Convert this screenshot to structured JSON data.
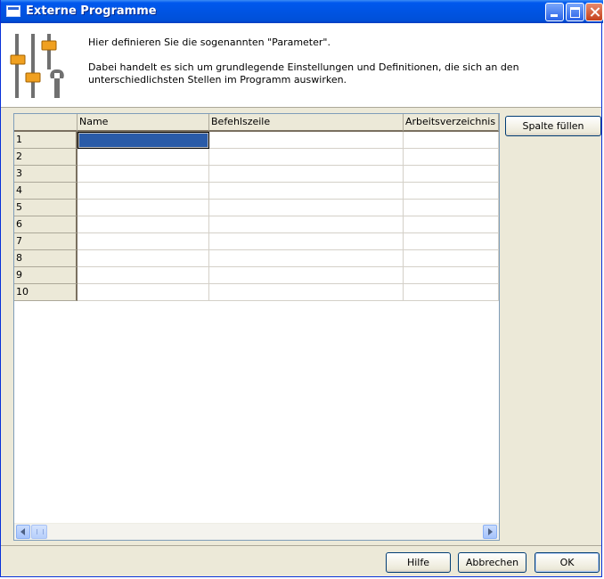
{
  "window": {
    "title": "Externe Programme"
  },
  "header": {
    "line1": "Hier definieren Sie die sogenannten \"Parameter\".",
    "line2": "Dabei handelt es sich um grundlegende Einstellungen und Definitionen, die sich an den unterschiedlichsten Stellen im Programm auswirken."
  },
  "grid": {
    "columns": [
      "Name",
      "Befehlszeile",
      "Arbeitsverzeichnis"
    ],
    "rows": [
      "1",
      "2",
      "3",
      "4",
      "5",
      "6",
      "7",
      "8",
      "9",
      "10"
    ],
    "selected_cell": {
      "row": 1,
      "column": "Name"
    }
  },
  "buttons": {
    "fill_column": "Spalte füllen",
    "help": "Hilfe",
    "cancel": "Abbrechen",
    "ok": "OK"
  },
  "colors": {
    "titlebar": "#0054e3",
    "dialog_bg": "#ece9d8",
    "selection": "#2a5ba8"
  },
  "icons": {
    "title": "window-icon",
    "header": "sliders-wrench-icon"
  }
}
